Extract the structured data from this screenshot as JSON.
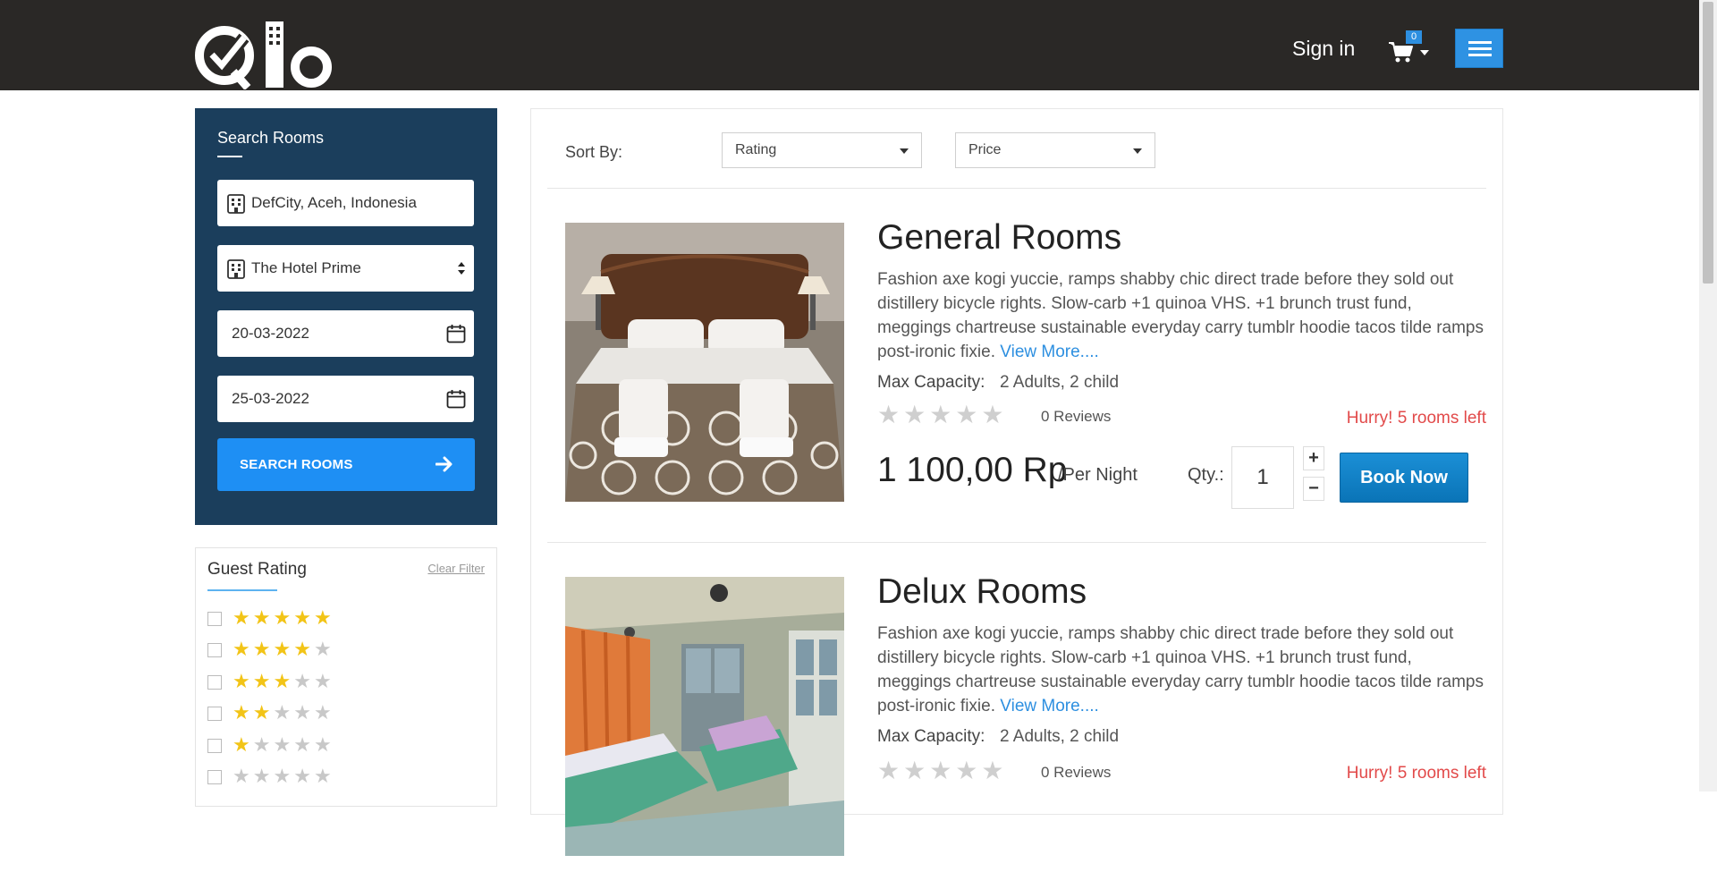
{
  "header": {
    "logo_text": "Qlo",
    "signin_label": "Sign in",
    "cart_count": "0"
  },
  "search": {
    "title": "Search Rooms",
    "location": "DefCity, Aceh, Indonesia",
    "hotel": "The Hotel Prime",
    "check_in": "20-03-2022",
    "check_out": "25-03-2022",
    "button_label": "SEARCH ROOMS"
  },
  "guest_rating": {
    "title": "Guest Rating",
    "clear_label": "Clear Filter",
    "options": [
      5,
      4,
      3,
      2,
      1,
      0
    ]
  },
  "sort": {
    "label": "Sort By:",
    "rating": "Rating",
    "price": "Price"
  },
  "rooms": [
    {
      "name": "General Rooms",
      "description": "Fashion axe kogi yuccie, ramps shabby chic direct trade before they sold out distillery bicycle rights. Slow-carb +1 quinoa VHS. +1 brunch trust fund, meggings chartreuse sustainable everyday carry tumblr hoodie tacos tilde ramps post-ironic fixie.",
      "view_more": "View More....",
      "capacity_label": "Max Capacity:",
      "capacity": "2 Adults, 2 child",
      "rating": 0,
      "reviews": "0 Reviews",
      "availability": "Hurry! 5 rooms left",
      "price": "1 100,00 Rp",
      "per_night": "/Per Night",
      "qty_label": "Qty.:",
      "qty": "1",
      "book_label": "Book Now"
    },
    {
      "name": "Delux Rooms",
      "description": "Fashion axe kogi yuccie, ramps shabby chic direct trade before they sold out distillery bicycle rights. Slow-carb +1 quinoa VHS. +1 brunch trust fund, meggings chartreuse sustainable everyday carry tumblr hoodie tacos tilde ramps post-ironic fixie.",
      "view_more": "View More....",
      "capacity_label": "Max Capacity:",
      "capacity": "2 Adults, 2 child",
      "rating": 0,
      "reviews": "0 Reviews",
      "availability": "Hurry! 5 rooms left"
    }
  ],
  "colors": {
    "header_bg": "#2a2826",
    "panel_bg": "#1b3e5c",
    "accent": "#1e8ff4",
    "book_button": "#1b8fd6",
    "alert": "#e24a4a",
    "star": "#f2c417"
  },
  "icons": [
    "qlo-logo",
    "hotel-icon",
    "calendar-icon",
    "arrow-right-icon",
    "cart-icon",
    "hamburger-icon",
    "star-icon"
  ]
}
